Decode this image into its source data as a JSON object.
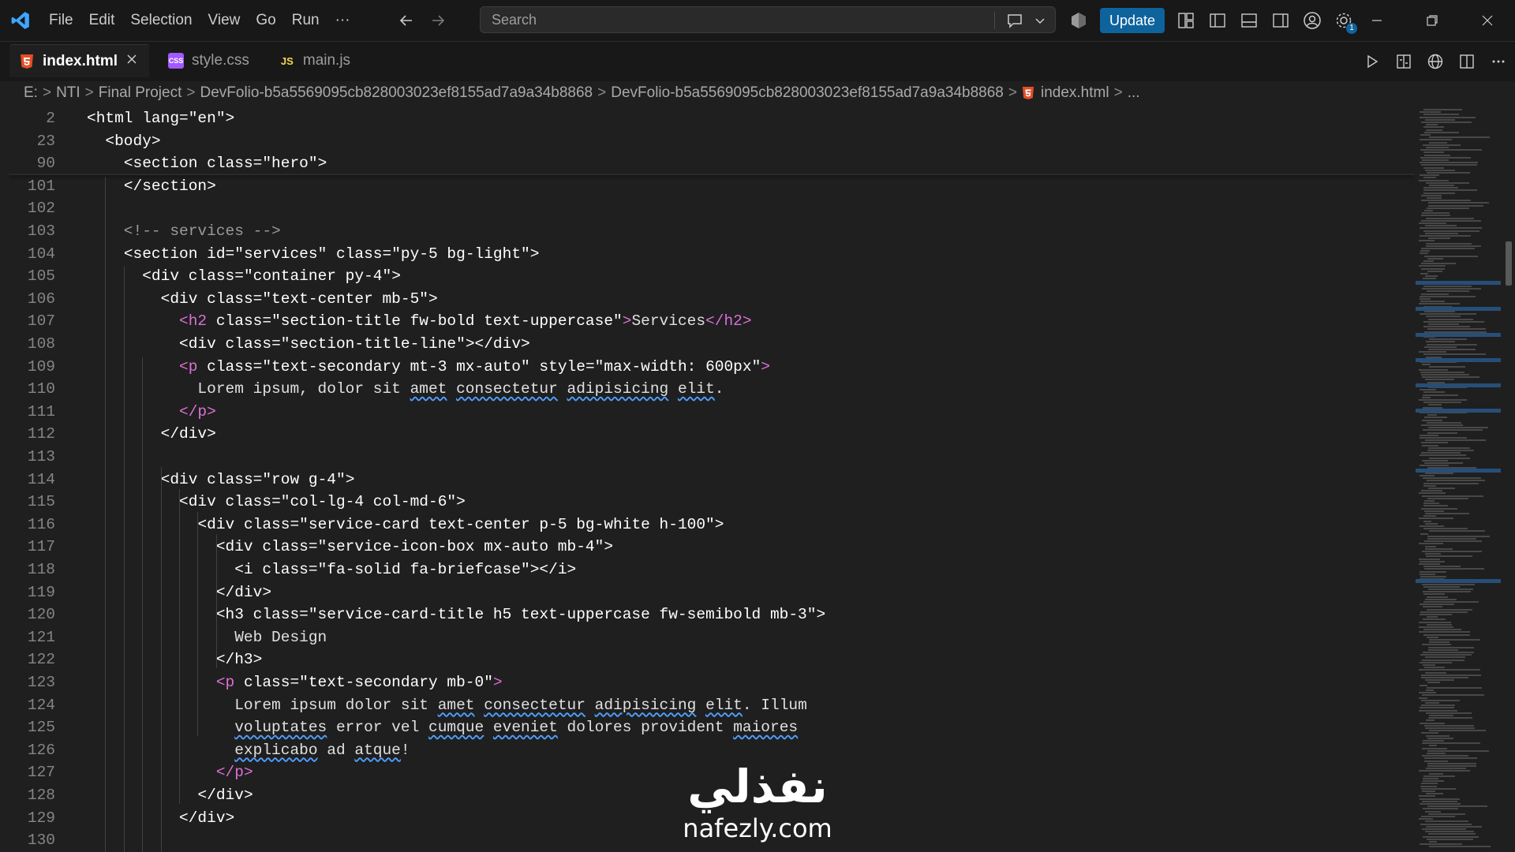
{
  "menu": [
    "File",
    "Edit",
    "Selection",
    "View",
    "Go",
    "Run",
    "···"
  ],
  "search": {
    "placeholder": "Search"
  },
  "update_label": "Update",
  "settings_badge": "1",
  "tabs": [
    {
      "label": "index.html",
      "icon": "html5-icon",
      "active": true
    },
    {
      "label": "style.css",
      "icon": "css-icon",
      "active": false
    },
    {
      "label": "main.js",
      "icon": "js-icon",
      "active": false
    }
  ],
  "tab_icon_text": {
    "js": "JS",
    "css": "CSS"
  },
  "breadcrumb": [
    "E:",
    "NTI",
    "Final Project",
    "DevFolio-b5a5569095cb828003023ef8155ad7a9a34b8868",
    "DevFolio-b5a5569095cb828003023ef8155ad7a9a34b8868",
    "index.html",
    "..."
  ],
  "editor": {
    "lines": [
      {
        "n": "2",
        "code": "<html lang=\"en\">"
      },
      {
        "n": "23",
        "code": "  <body>"
      },
      {
        "n": "90",
        "code": "    <section class=\"hero\">"
      },
      {
        "n": "101",
        "code": "    </section>"
      },
      {
        "n": "102",
        "code": ""
      },
      {
        "n": "103",
        "code": "    <!-- services -->"
      },
      {
        "n": "104",
        "code": "    <section id=\"services\" class=\"py-5 bg-light\">"
      },
      {
        "n": "105",
        "code": "      <div class=\"container py-4\">"
      },
      {
        "n": "106",
        "code": "        <div class=\"text-center mb-5\">"
      },
      {
        "n": "107",
        "code": "          <h2 class=\"section-title fw-bold text-uppercase\">Services</h2>"
      },
      {
        "n": "108",
        "code": "          <div class=\"section-title-line\"></div>"
      },
      {
        "n": "109",
        "code": "          <p class=\"text-secondary mt-3 mx-auto\" style=\"max-width: 600px\">"
      },
      {
        "n": "110",
        "code": "            Lorem ipsum, dolor sit amet consectetur adipisicing elit."
      },
      {
        "n": "111",
        "code": "          </p>"
      },
      {
        "n": "112",
        "code": "        </div>"
      },
      {
        "n": "113",
        "code": ""
      },
      {
        "n": "114",
        "code": "        <div class=\"row g-4\">"
      },
      {
        "n": "115",
        "code": "          <div class=\"col-lg-4 col-md-6\">"
      },
      {
        "n": "116",
        "code": "            <div class=\"service-card text-center p-5 bg-white h-100\">"
      },
      {
        "n": "117",
        "code": "              <div class=\"service-icon-box mx-auto mb-4\">"
      },
      {
        "n": "118",
        "code": "                <i class=\"fa-solid fa-briefcase\"></i>"
      },
      {
        "n": "119",
        "code": "              </div>"
      },
      {
        "n": "120",
        "code": "              <h3 class=\"service-card-title h5 text-uppercase fw-semibold mb-3\">"
      },
      {
        "n": "121",
        "code": "                Web Design"
      },
      {
        "n": "122",
        "code": "              </h3>"
      },
      {
        "n": "123",
        "code": "              <p class=\"text-secondary mb-0\">"
      },
      {
        "n": "124",
        "code": "                Lorem ipsum dolor sit amet consectetur adipisicing elit. Illum"
      },
      {
        "n": "125",
        "code": "                voluptates error vel cumque eveniet dolores provident maiores"
      },
      {
        "n": "126",
        "code": "                explicabo ad atque!"
      },
      {
        "n": "127",
        "code": "              </p>"
      },
      {
        "n": "128",
        "code": "            </div>"
      },
      {
        "n": "129",
        "code": "          </div>"
      },
      {
        "n": "130",
        "code": ""
      }
    ]
  },
  "watermark": {
    "arabic": "نفذلي",
    "latin": "nafezly.com"
  },
  "colors": {
    "accent": "#0e639c",
    "html_icon": "#e44d26",
    "css_icon": "#a259ff",
    "js_icon": "#f0db4f"
  }
}
